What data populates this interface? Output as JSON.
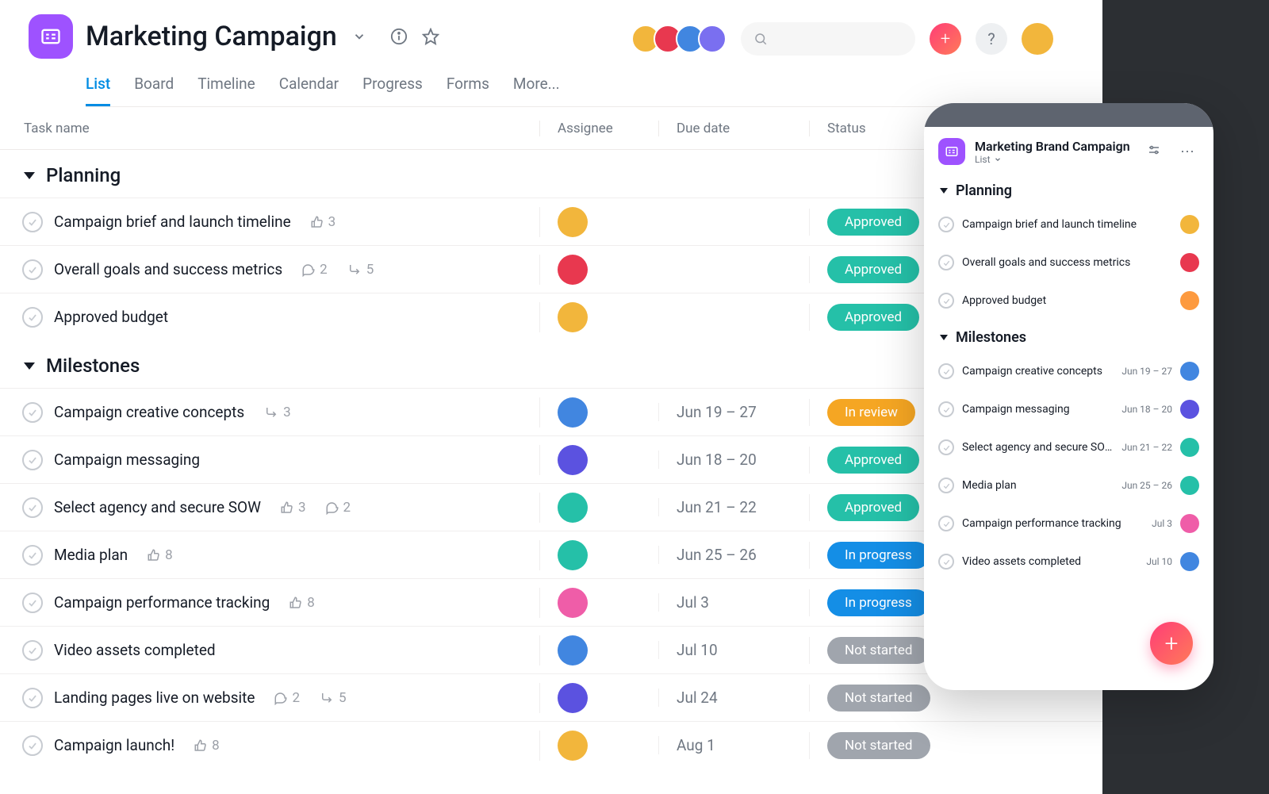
{
  "project": {
    "title": "Marketing Campaign"
  },
  "tabs": [
    "List",
    "Board",
    "Timeline",
    "Calendar",
    "Progress",
    "Forms",
    "More..."
  ],
  "activeTab": "List",
  "columns": {
    "task": "Task name",
    "assignee": "Assignee",
    "due": "Due date",
    "status": "Status"
  },
  "sections": [
    {
      "name": "Planning",
      "tasks": [
        {
          "name": "Campaign brief and launch timeline",
          "likes": "3",
          "comments": "",
          "subtasks": "",
          "assignee": "av-yellow",
          "due": "",
          "status": "Approved",
          "statusClass": "pill-teal"
        },
        {
          "name": "Overall goals and success metrics",
          "likes": "",
          "comments": "2",
          "subtasks": "5",
          "assignee": "av-red",
          "due": "",
          "status": "Approved",
          "statusClass": "pill-teal"
        },
        {
          "name": "Approved budget",
          "likes": "",
          "comments": "",
          "subtasks": "",
          "assignee": "av-yellow",
          "due": "",
          "status": "Approved",
          "statusClass": "pill-teal"
        }
      ]
    },
    {
      "name": "Milestones",
      "tasks": [
        {
          "name": "Campaign creative concepts",
          "likes": "",
          "comments": "",
          "subtasks": "3",
          "assignee": "av-blue",
          "due": "Jun 19 – 27",
          "status": "In review",
          "statusClass": "pill-orange"
        },
        {
          "name": "Campaign messaging",
          "likes": "",
          "comments": "",
          "subtasks": "",
          "assignee": "av-indigo",
          "due": "Jun 18 – 20",
          "status": "Approved",
          "statusClass": "pill-teal"
        },
        {
          "name": "Select agency and secure SOW",
          "likes": "3",
          "comments": "2",
          "subtasks": "",
          "assignee": "av-teal",
          "due": "Jun 21 – 22",
          "status": "Approved",
          "statusClass": "pill-teal"
        },
        {
          "name": "Media plan",
          "likes": "8",
          "comments": "",
          "subtasks": "",
          "assignee": "av-teal",
          "due": "Jun 25 – 26",
          "status": "In progress",
          "statusClass": "pill-blue"
        },
        {
          "name": "Campaign performance tracking",
          "likes": "8",
          "comments": "",
          "subtasks": "",
          "assignee": "av-pink",
          "due": "Jul 3",
          "status": "In progress",
          "statusClass": "pill-blue"
        },
        {
          "name": "Video assets completed",
          "likes": "",
          "comments": "",
          "subtasks": "",
          "assignee": "av-blue",
          "due": "Jul 10",
          "status": "Not started",
          "statusClass": "pill-grey"
        },
        {
          "name": "Landing pages live on website",
          "likes": "",
          "comments": "2",
          "subtasks": "5",
          "assignee": "av-indigo",
          "due": "Jul 24",
          "status": "Not started",
          "statusClass": "pill-grey"
        },
        {
          "name": "Campaign launch!",
          "likes": "8",
          "comments": "",
          "subtasks": "",
          "assignee": "av-yellow",
          "due": "Aug 1",
          "status": "Not started",
          "statusClass": "pill-grey"
        }
      ]
    }
  ],
  "headerAvatars": [
    "av-yellow",
    "av-red",
    "av-blue",
    "av-purple"
  ],
  "help": "?",
  "mobile": {
    "title": "Marketing Brand Campaign",
    "sub": "List",
    "sections": [
      {
        "name": "Planning",
        "tasks": [
          {
            "name": "Campaign brief and launch timeline",
            "due": "",
            "av": "av-yellow"
          },
          {
            "name": "Overall goals and success metrics",
            "due": "",
            "av": "av-red"
          },
          {
            "name": "Approved budget",
            "due": "",
            "av": "av-orange"
          }
        ]
      },
      {
        "name": "Milestones",
        "tasks": [
          {
            "name": "Campaign creative concepts",
            "due": "Jun 19 – 27",
            "av": "av-blue"
          },
          {
            "name": "Campaign messaging",
            "due": "Jun 18 – 20",
            "av": "av-indigo"
          },
          {
            "name": "Select agency and secure SOW",
            "due": "Jun 21 – 22",
            "av": "av-teal"
          },
          {
            "name": "Media plan",
            "due": "Jun 25 – 26",
            "av": "av-teal"
          },
          {
            "name": "Campaign performance tracking",
            "due": "Jul 3",
            "av": "av-pink"
          },
          {
            "name": "Video assets completed",
            "due": "Jul 10",
            "av": "av-blue"
          }
        ]
      }
    ]
  }
}
